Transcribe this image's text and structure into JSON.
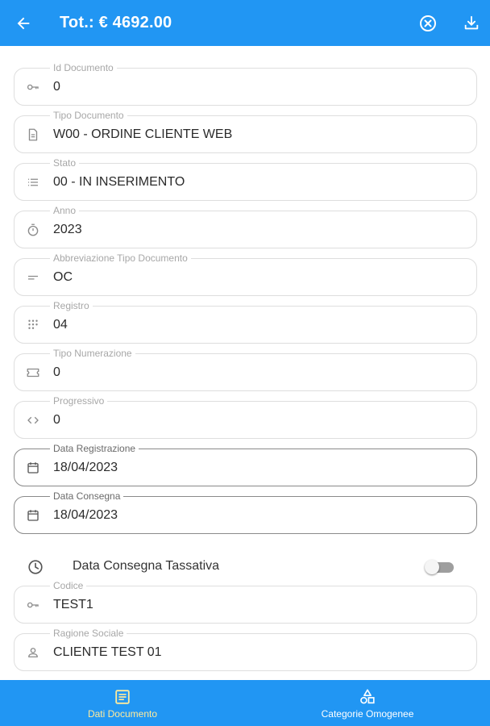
{
  "appbar": {
    "title": "Tot.: € 4692.00",
    "back_icon": "arrow-back-icon",
    "cancel_icon": "cancel-circle-icon",
    "download_icon": "download-icon",
    "color": "#2196f3"
  },
  "fields": {
    "id_documento": {
      "label": "Id Documento",
      "value": "0",
      "icon": "key-icon"
    },
    "tipo_documento": {
      "label": "Tipo Documento",
      "value": "W00 - ORDINE CLIENTE WEB",
      "icon": "document-icon"
    },
    "stato": {
      "label": "Stato",
      "value": "00 - IN INSERIMENTO",
      "icon": "list-icon"
    },
    "anno": {
      "label": "Anno",
      "value": "2023",
      "icon": "timer-icon"
    },
    "abbreviazione": {
      "label": "Abbreviazione Tipo Documento",
      "value": "OC",
      "icon": "short-text-icon"
    },
    "registro": {
      "label": "Registro",
      "value": "04",
      "icon": "dialpad-icon"
    },
    "tipo_numerazione": {
      "label": "Tipo Numerazione",
      "value": "0",
      "icon": "ticket-icon"
    },
    "progressivo": {
      "label": "Progressivo",
      "value": "0",
      "icon": "code-icon"
    },
    "data_registrazione": {
      "label": "Data Registrazione",
      "value": "18/04/2023",
      "icon": "calendar-icon"
    },
    "data_consegna": {
      "label": "Data Consegna",
      "value": "18/04/2023",
      "icon": "calendar-icon"
    },
    "codice": {
      "label": "Codice",
      "value": "TEST1",
      "icon": "key-icon"
    },
    "ragione_sociale": {
      "label": "Ragione Sociale",
      "value": "CLIENTE TEST 01",
      "icon": "person-icon"
    }
  },
  "toggle": {
    "label": "Data Consegna Tassativa",
    "checked": false,
    "icon": "clock-icon"
  },
  "bottom_nav": {
    "tabs": [
      {
        "label": "Dati Documento",
        "icon": "article-icon",
        "selected": true,
        "color": "#ffeb9c"
      },
      {
        "label": "Categorie Omogenee",
        "icon": "category-shapes-icon",
        "selected": false,
        "color": "#ffffff"
      }
    ]
  }
}
